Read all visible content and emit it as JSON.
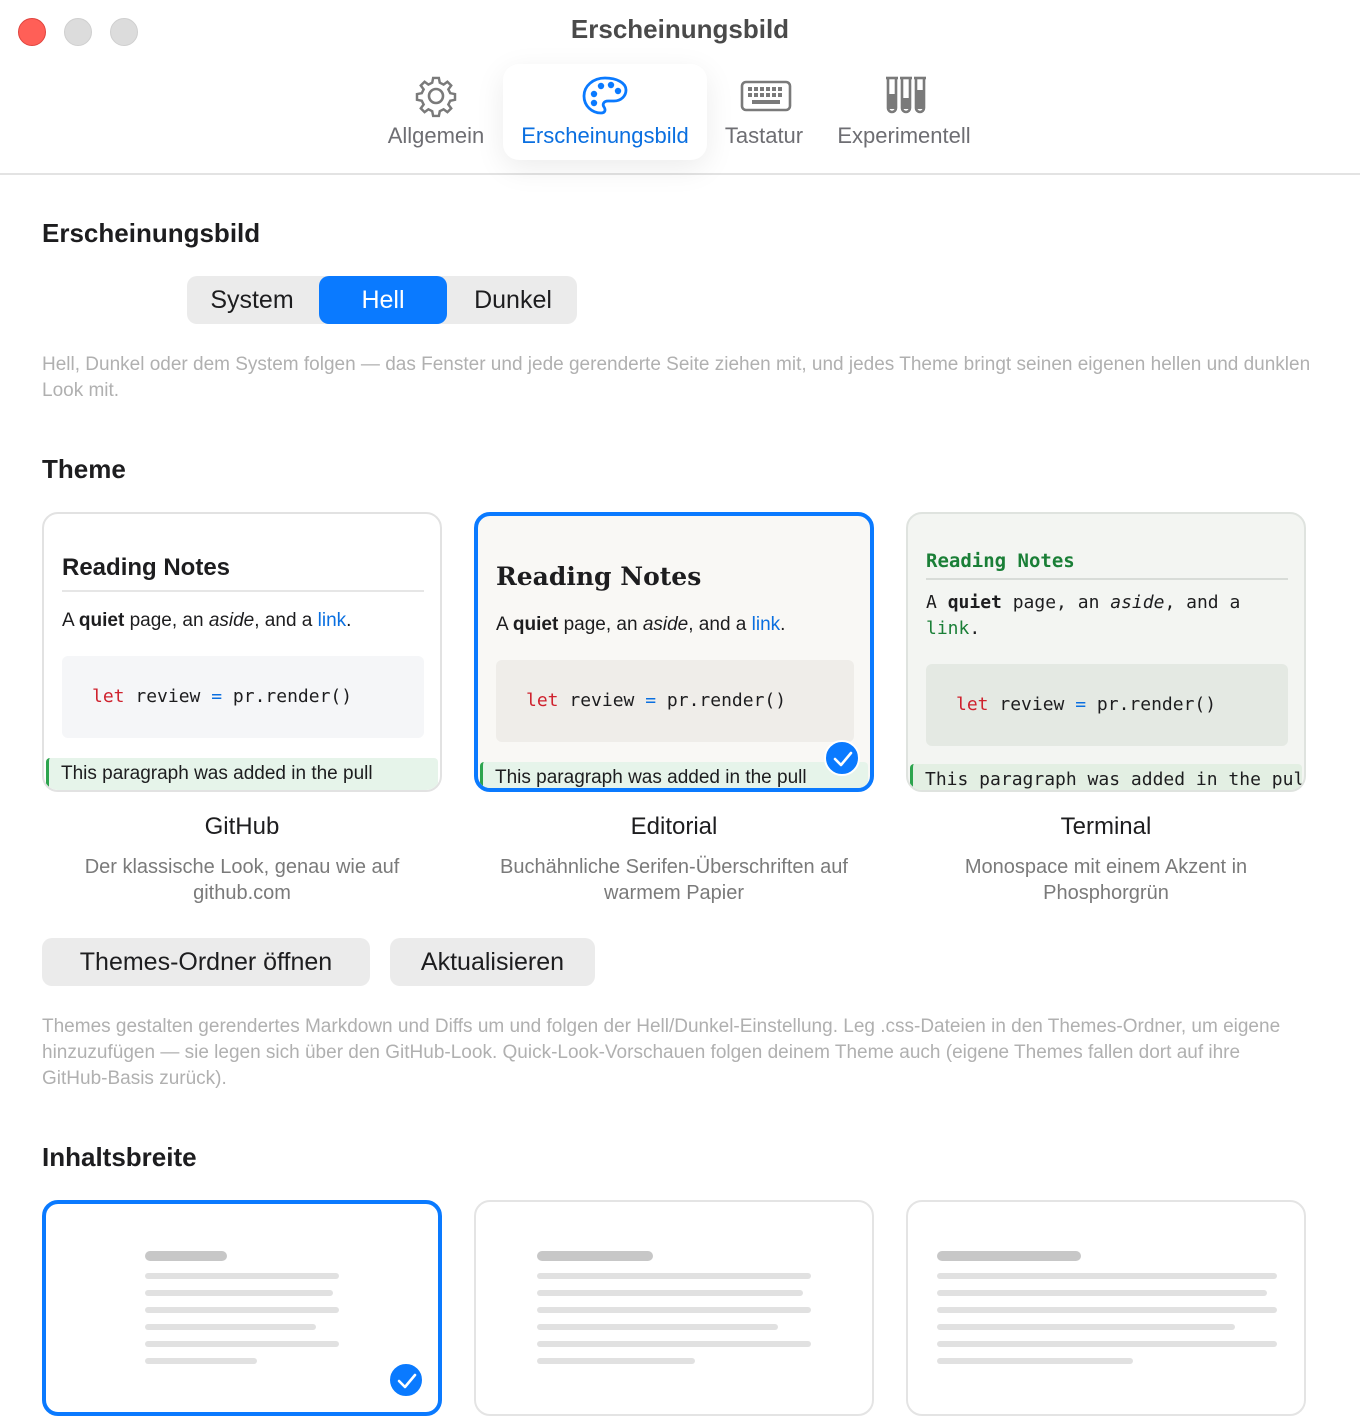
{
  "window": {
    "title": "Erscheinungsbild"
  },
  "tabs": [
    {
      "label": "Allgemein",
      "icon": "gear-icon"
    },
    {
      "label": "Erscheinungsbild",
      "icon": "palette-icon",
      "active": true
    },
    {
      "label": "Tastatur",
      "icon": "keyboard-icon"
    },
    {
      "label": "Experimentell",
      "icon": "test-tubes-icon"
    }
  ],
  "appearance": {
    "heading": "Erscheinungsbild",
    "options": [
      "System",
      "Hell",
      "Dunkel"
    ],
    "selected": "Hell",
    "hint": "Hell, Dunkel oder dem System folgen — das Fenster und jede gerenderte Seite ziehen mit, und jedes Theme bringt seinen eigenen hellen und dunklen Look mit."
  },
  "theme": {
    "heading": "Theme",
    "preview": {
      "title": "Reading Notes",
      "para_a": "A ",
      "para_quiet": "quiet",
      "para_b": " page, an ",
      "para_aside": "aside",
      "para_c": ", and a ",
      "para_link": "link",
      "para_d": ".",
      "code_kw": "let",
      "code_mid": " review ",
      "code_op": "=",
      "code_end": " pr.render()",
      "added": "This paragraph was added in the pull"
    },
    "cards": [
      {
        "name": "GitHub",
        "description": "Der klassische Look, genau wie auf github.com"
      },
      {
        "name": "Editorial",
        "description": "Buchähnliche Serifen-Überschriften auf warmem Papier",
        "selected": true
      },
      {
        "name": "Terminal",
        "description": "Monospace mit einem Akzent in Phosphorgrün"
      }
    ],
    "open_folder_button": "Themes-Ordner öffnen",
    "refresh_button": "Aktualisieren",
    "hint": "Themes gestalten gerendertes Markdown und Diffs um und folgen der Hell/Dunkel-Einstellung. Leg .css-Dateien in den Themes-Ordner, um eigene hinzuzufügen — sie legen sich über den GitHub-Look. Quick-Look-Vorschauen folgen deinem Theme auch (eigene Themes fallen dort auf ihre GitHub-Basis zurück)."
  },
  "content_width": {
    "heading": "Inhaltsbreite",
    "options": [
      "narrow",
      "medium",
      "wide"
    ],
    "selected": "narrow"
  },
  "colors": {
    "accent": "#0a7aff",
    "close": "#ff5f57",
    "added_green": "#2da44e",
    "keyword_red": "#cf222e",
    "terminal_green": "#1a7f37"
  }
}
